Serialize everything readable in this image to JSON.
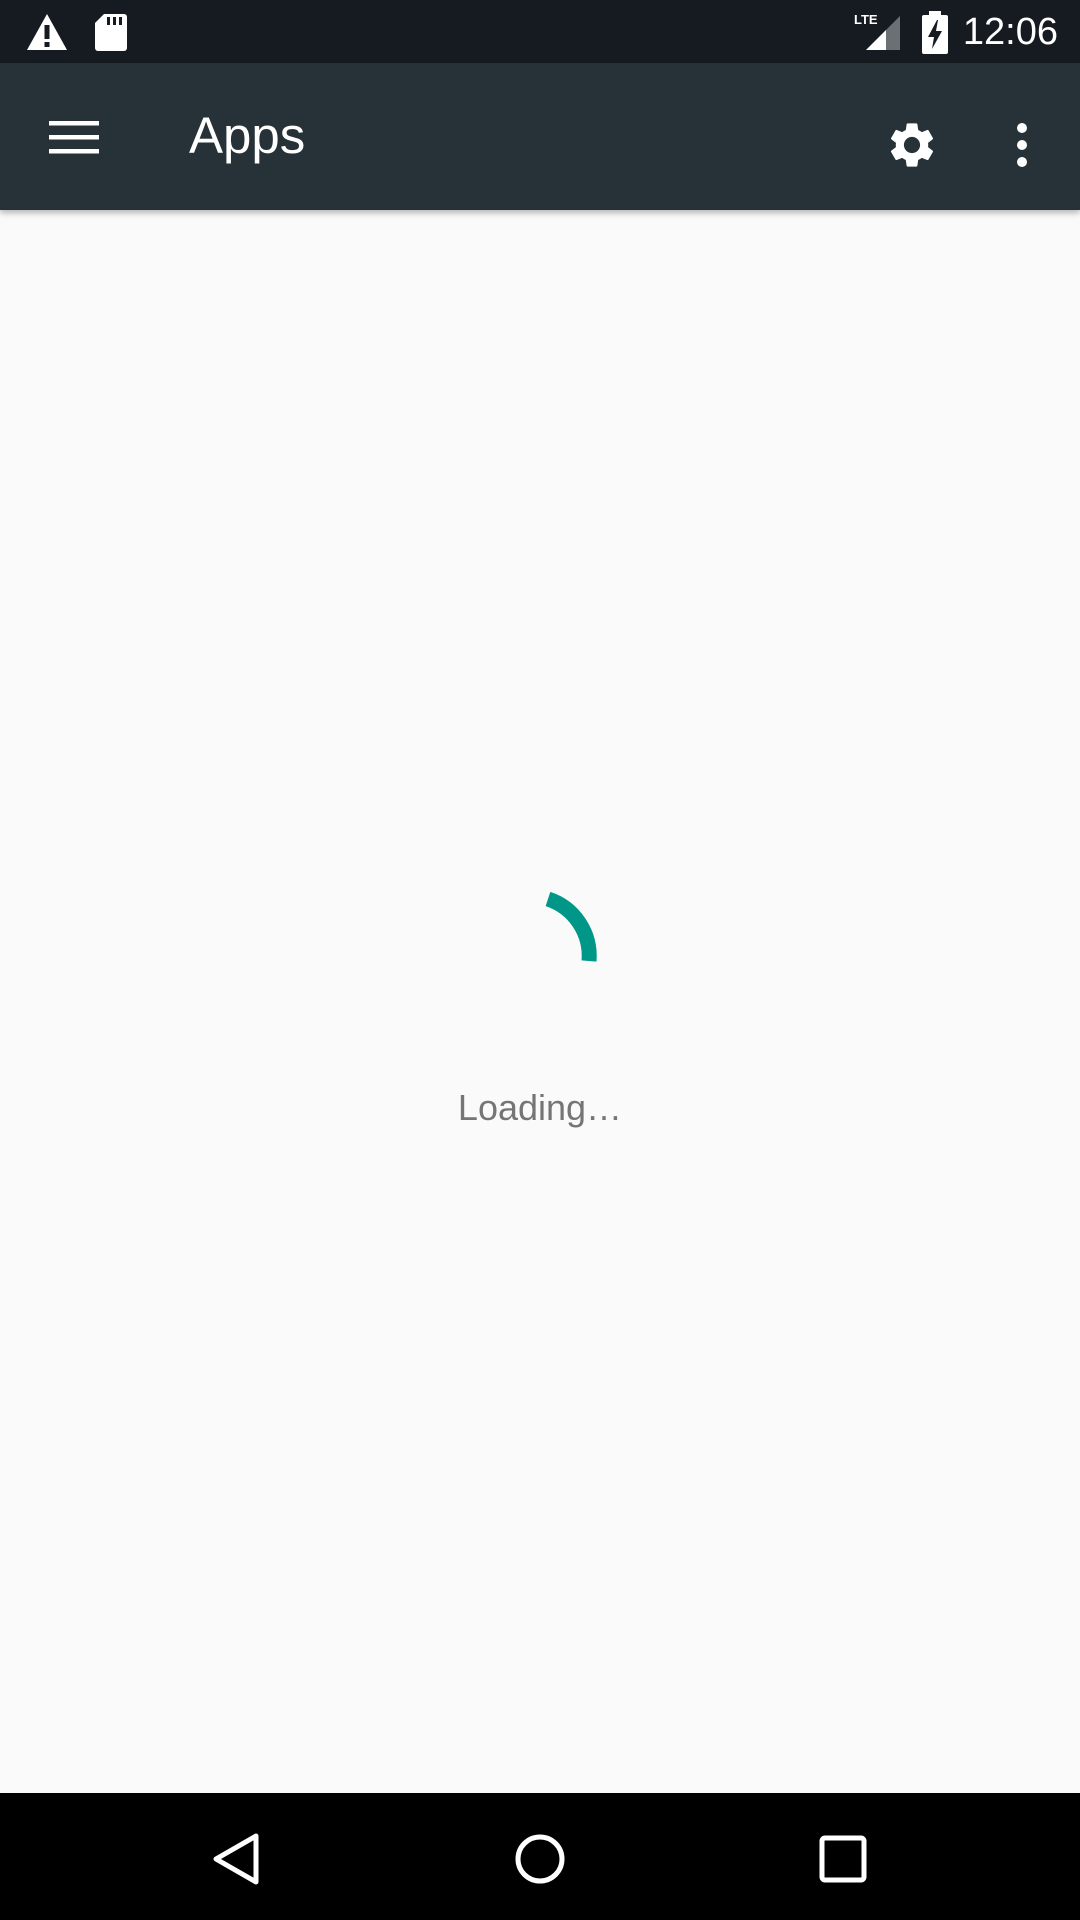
{
  "status_bar": {
    "time": "12:06",
    "network_label": "LTE",
    "icons": [
      "warning-icon",
      "sd-card-icon",
      "lte-signal-icon",
      "battery-charging-icon"
    ]
  },
  "toolbar": {
    "title": "Apps",
    "background_color": "#263238",
    "icons": [
      "menu-icon",
      "gear-icon",
      "overflow-menu-icon"
    ]
  },
  "content": {
    "loading_text": "Loading…",
    "spinner_color": "#009688"
  },
  "nav_bar": {
    "icons": [
      "back-icon",
      "home-icon",
      "recents-icon"
    ]
  }
}
